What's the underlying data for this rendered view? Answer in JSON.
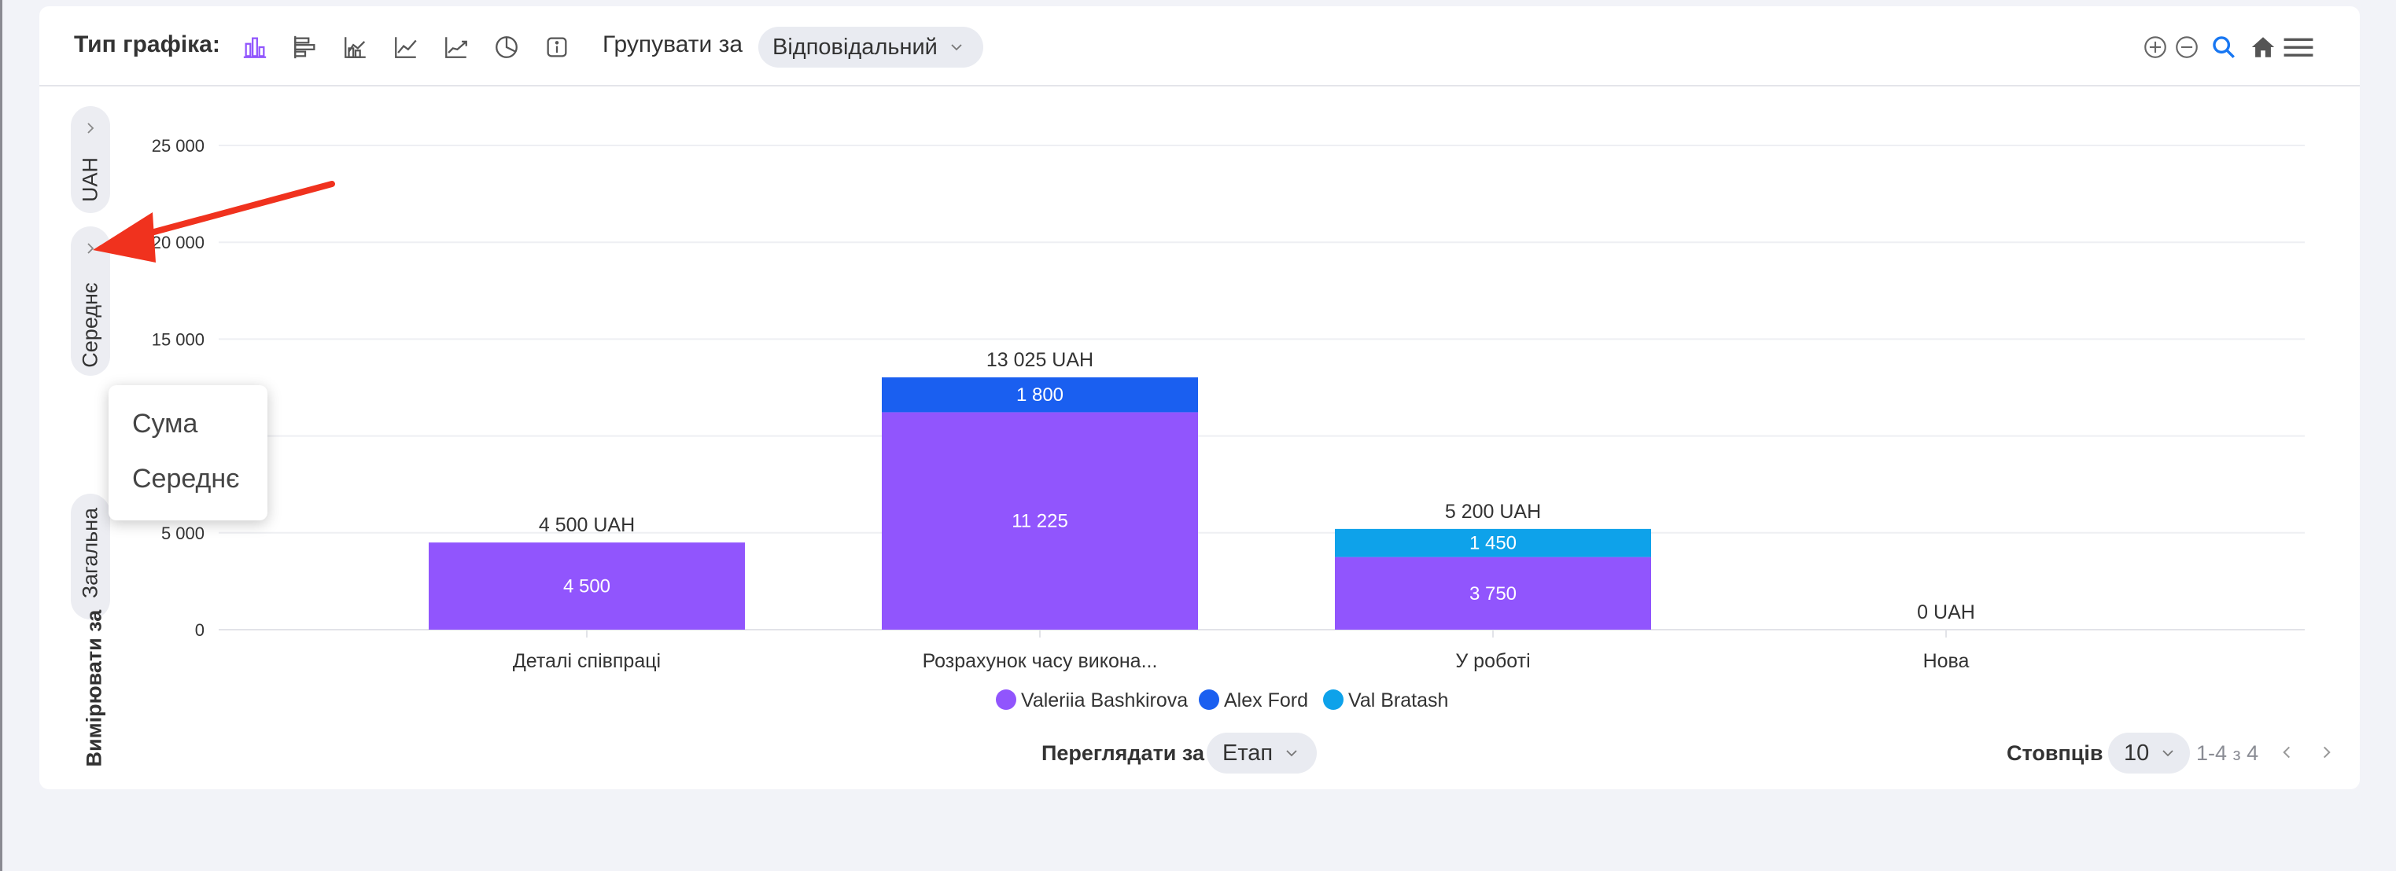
{
  "toolbar": {
    "chart_type_label": "Тип графіка:",
    "chart_type_icons": [
      "bar-chart-icon",
      "horizontal-bar-icon",
      "area-chart-icon",
      "line-chart-icon",
      "line-chart-alt-icon",
      "pie-chart-icon",
      "info-icon"
    ],
    "group_by_label": "Групувати за",
    "group_by_value": "Відповідальний",
    "right_icons": [
      "zoom-in-icon",
      "zoom-out-icon",
      "zoom-select-icon",
      "home-icon",
      "menu-icon"
    ]
  },
  "side": {
    "unit_tab": "UAH",
    "aggregate_tab": "Середнє",
    "metric_tab": "Загальна",
    "measure_label": "Вимірювати за"
  },
  "dropdown": {
    "options": [
      "Сума",
      "Середнє"
    ]
  },
  "chart_data": {
    "type": "bar",
    "stacked": true,
    "categories": [
      "Деталі співпраці",
      "Розрахунок часу викона...",
      "У роботі",
      "Нова"
    ],
    "series": [
      {
        "name": "Valeriia Bashkirova",
        "color": "#9155fd",
        "values": [
          4500,
          11225,
          3750,
          0
        ]
      },
      {
        "name": "Alex Ford",
        "color": "#1a5ff0",
        "values": [
          0,
          1800,
          0,
          0
        ]
      },
      {
        "name": "Val Bratash",
        "color": "#0ea2ea",
        "values": [
          0,
          0,
          1450,
          0
        ]
      }
    ],
    "segment_labels": [
      [
        "4 500",
        "",
        ""
      ],
      [
        "11 225",
        "1 800",
        ""
      ],
      [
        "3 750",
        "",
        "1 450"
      ],
      [
        "",
        "",
        ""
      ]
    ],
    "totals": [
      "4 500 UAH",
      "13 025 UAH",
      "5 200 UAH",
      "0 UAH"
    ],
    "y_ticks": [
      0,
      5000,
      15000,
      20000,
      25000
    ],
    "y_tick_labels": [
      "0",
      "5 000",
      "15 000",
      "20 000",
      "25 000"
    ],
    "ylim": [
      0,
      25000
    ],
    "grid": true,
    "legend_position": "bottom"
  },
  "bottom": {
    "view_by_label": "Переглядати за",
    "view_by_value": "Етап",
    "columns_label": "Стовпців",
    "columns_value": "10",
    "range_text": "1-4",
    "of_text": "з",
    "total_text": "4"
  },
  "colors": {
    "accent": "#9155fd",
    "annotation_arrow": "#f0321e"
  }
}
